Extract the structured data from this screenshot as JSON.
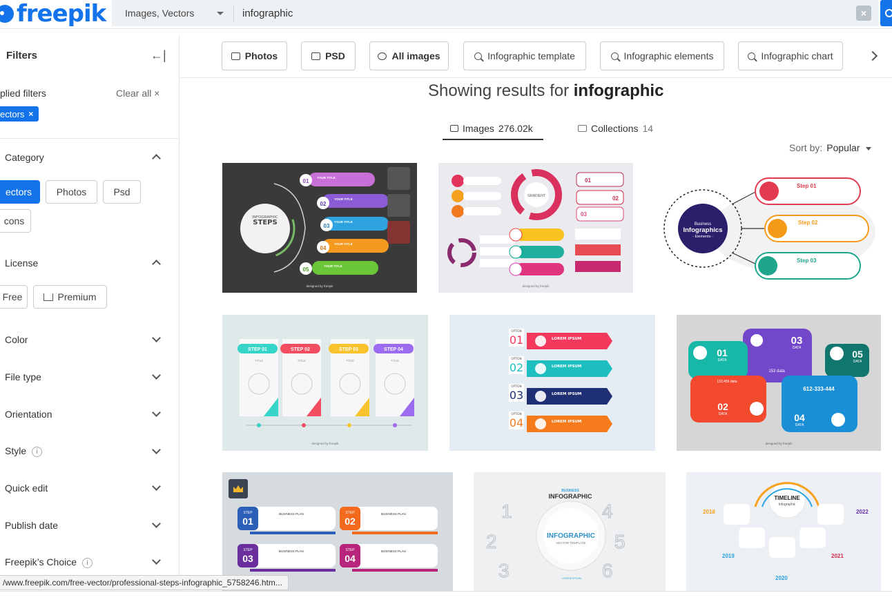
{
  "brand": {
    "name": "freepik",
    "color": "#1273eb"
  },
  "search": {
    "type_label": "Images, Vectors",
    "value": "infographic",
    "clear": "×"
  },
  "sidebar": {
    "title": "Filters",
    "applied_label": "plied filters",
    "clear_all": "Clear all ×",
    "applied_chip": "ectors",
    "category": {
      "title": "Category",
      "options": [
        "ectors",
        "Photos",
        "Psd",
        "cons"
      ]
    },
    "license": {
      "title": "License",
      "options": [
        "Free",
        "Premium"
      ]
    },
    "sections": [
      "Color",
      "File type",
      "Orientation",
      "Style",
      "Quick edit",
      "Publish date",
      "Freepik’s Choice"
    ]
  },
  "quick_filters": [
    "Photos",
    "PSD",
    "All images",
    "Infographic template",
    "Infographic elements",
    "Infographic chart"
  ],
  "results": {
    "prefix": "Showing results for",
    "query": "infographic",
    "tabs": [
      {
        "label": "Images",
        "count": "276.02k"
      },
      {
        "label": "Collections",
        "count": "14"
      }
    ],
    "sort_label": "Sort by:",
    "sort_value": "Popular"
  },
  "thumbnails": {
    "t1": {
      "title1": "INFOGRAPHIC",
      "title2": "STEPS",
      "steps": [
        "01",
        "02",
        "03",
        "04",
        "05"
      ],
      "item": "YOUR TITLE",
      "credit": "designed by freepik"
    },
    "t2": {
      "center": "GRADIENT",
      "steps": [
        "01",
        "02",
        "03"
      ],
      "credit": "designed by freepik"
    },
    "t3": {
      "line1": "Business",
      "line2": "Infographics",
      "line3": "- Elements -",
      "steps": [
        "Step 01",
        "Step 02",
        "Step 03"
      ]
    },
    "t4": {
      "steps": [
        "STEP 01",
        "STEP 02",
        "STEP 03",
        "STEP 04"
      ],
      "title": "TITLE",
      "credit": "designed by freepik"
    },
    "t5": {
      "option": "OPTION",
      "nums": [
        "01",
        "02",
        "03",
        "04"
      ],
      "label": "LOREM IPSUM"
    },
    "t6": {
      "nums": [
        "01",
        "02",
        "03",
        "04",
        "05"
      ],
      "data": "DATA",
      "values": [
        "153 data",
        "133,456 data",
        "612-333-444"
      ],
      "credit": "designed by freepik"
    },
    "t7": {
      "step": "STEP",
      "nums": [
        "01",
        "02",
        "03",
        "04"
      ],
      "label": "BUSINESS PLAN"
    },
    "t8": {
      "top1": "BUSINESS",
      "top2": "INFOGRAPHIC",
      "center1": "INFOGRAPHIC",
      "center2": "VECTOR TEMPLATE",
      "nums": [
        "1",
        "2",
        "3",
        "4",
        "5",
        "6"
      ],
      "lorem": "LOREM IPSUM"
    },
    "t9": {
      "title1": "TIMELINE",
      "title2": "Infographic",
      "years": [
        "2018",
        "2019",
        "2020",
        "2021",
        "2022"
      ]
    }
  },
  "status_url": "/www.freepik.com/free-vector/professional-steps-infographic_5758246.htm..."
}
